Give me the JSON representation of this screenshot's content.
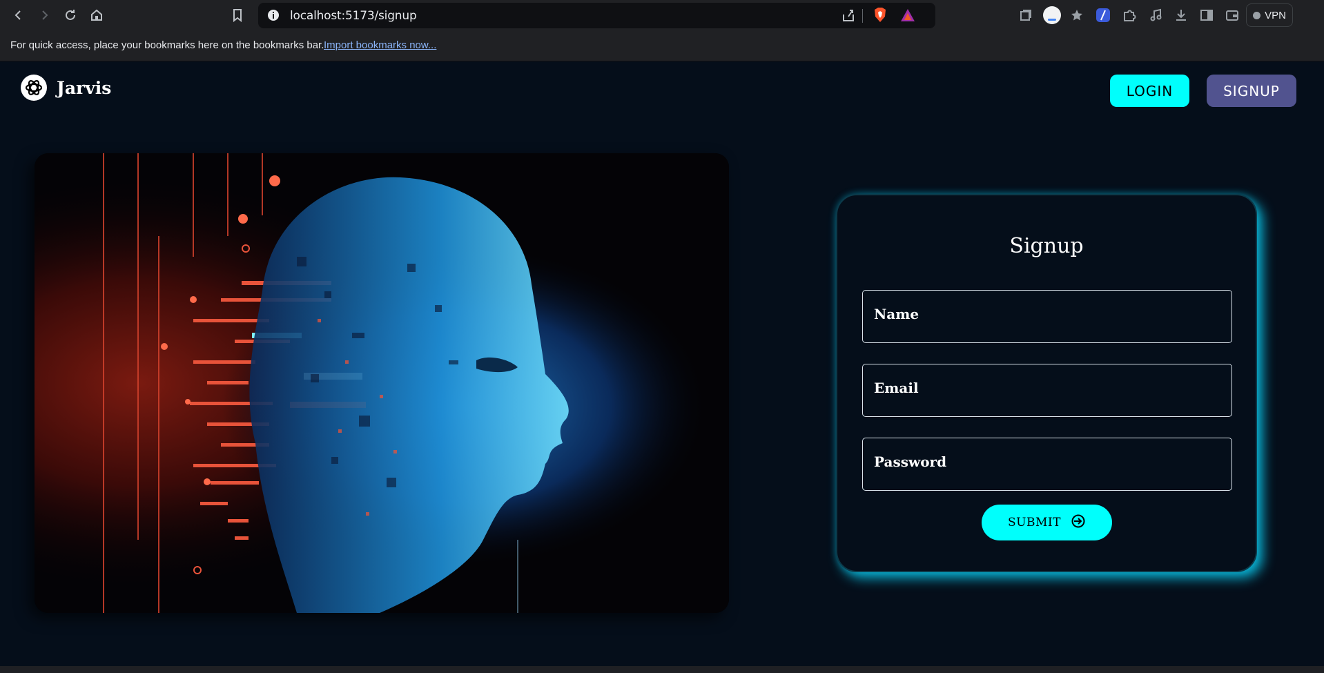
{
  "browser": {
    "url": "localhost:5173/signup",
    "bookmarks_text": "For quick access, place your bookmarks here on the bookmarks bar.",
    "bookmarks_link": "Import bookmarks now...",
    "vpn_label": "VPN"
  },
  "header": {
    "brand": "Jarvis",
    "login_label": "LOGIN",
    "signup_label": "SIGNUP"
  },
  "form": {
    "title": "Signup",
    "name_label": "Name",
    "email_label": "Email",
    "password_label": "Password",
    "submit_label": "SUBMIT"
  },
  "colors": {
    "accent": "#00fffc",
    "secondary": "#51538f",
    "background": "#050e1a"
  }
}
